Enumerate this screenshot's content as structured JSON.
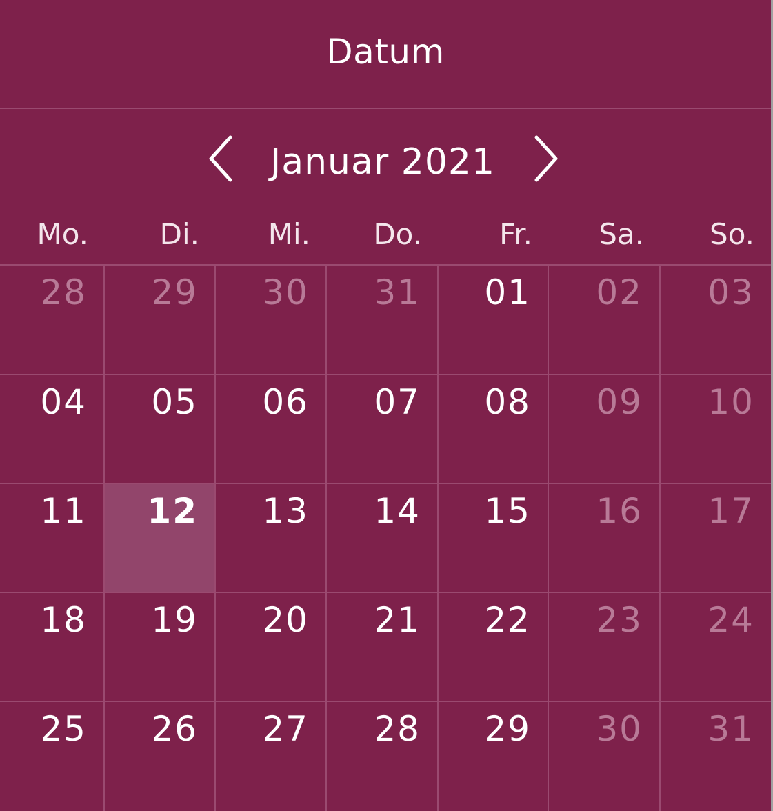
{
  "header": {
    "title": "Datum"
  },
  "nav": {
    "month_label": "Januar 2021",
    "prev_icon": "chevron-left-icon",
    "next_icon": "chevron-right-icon"
  },
  "weekdays": [
    "Mo.",
    "Di.",
    "Mi.",
    "Do.",
    "Fr.",
    "Sa.",
    "So."
  ],
  "weeks": [
    [
      {
        "label": "28",
        "muted": true
      },
      {
        "label": "29",
        "muted": true
      },
      {
        "label": "30",
        "muted": true
      },
      {
        "label": "31",
        "muted": true
      },
      {
        "label": "01",
        "muted": false
      },
      {
        "label": "02",
        "muted": true
      },
      {
        "label": "03",
        "muted": true
      }
    ],
    [
      {
        "label": "04",
        "muted": false
      },
      {
        "label": "05",
        "muted": false
      },
      {
        "label": "06",
        "muted": false
      },
      {
        "label": "07",
        "muted": false
      },
      {
        "label": "08",
        "muted": false
      },
      {
        "label": "09",
        "muted": true
      },
      {
        "label": "10",
        "muted": true
      }
    ],
    [
      {
        "label": "11",
        "muted": false
      },
      {
        "label": "12",
        "muted": false,
        "selected": true
      },
      {
        "label": "13",
        "muted": false
      },
      {
        "label": "14",
        "muted": false
      },
      {
        "label": "15",
        "muted": false
      },
      {
        "label": "16",
        "muted": true
      },
      {
        "label": "17",
        "muted": true
      }
    ],
    [
      {
        "label": "18",
        "muted": false
      },
      {
        "label": "19",
        "muted": false
      },
      {
        "label": "20",
        "muted": false
      },
      {
        "label": "21",
        "muted": false
      },
      {
        "label": "22",
        "muted": false
      },
      {
        "label": "23",
        "muted": true
      },
      {
        "label": "24",
        "muted": true
      }
    ],
    [
      {
        "label": "25",
        "muted": false
      },
      {
        "label": "26",
        "muted": false
      },
      {
        "label": "27",
        "muted": false
      },
      {
        "label": "28",
        "muted": false
      },
      {
        "label": "29",
        "muted": false
      },
      {
        "label": "30",
        "muted": true
      },
      {
        "label": "31",
        "muted": true
      }
    ]
  ],
  "colors": {
    "background": "#7e214b",
    "grid_line": "#9a4a70",
    "selected_cell": "#92456b",
    "muted_text": "#b87a97",
    "text": "#ffffff"
  }
}
